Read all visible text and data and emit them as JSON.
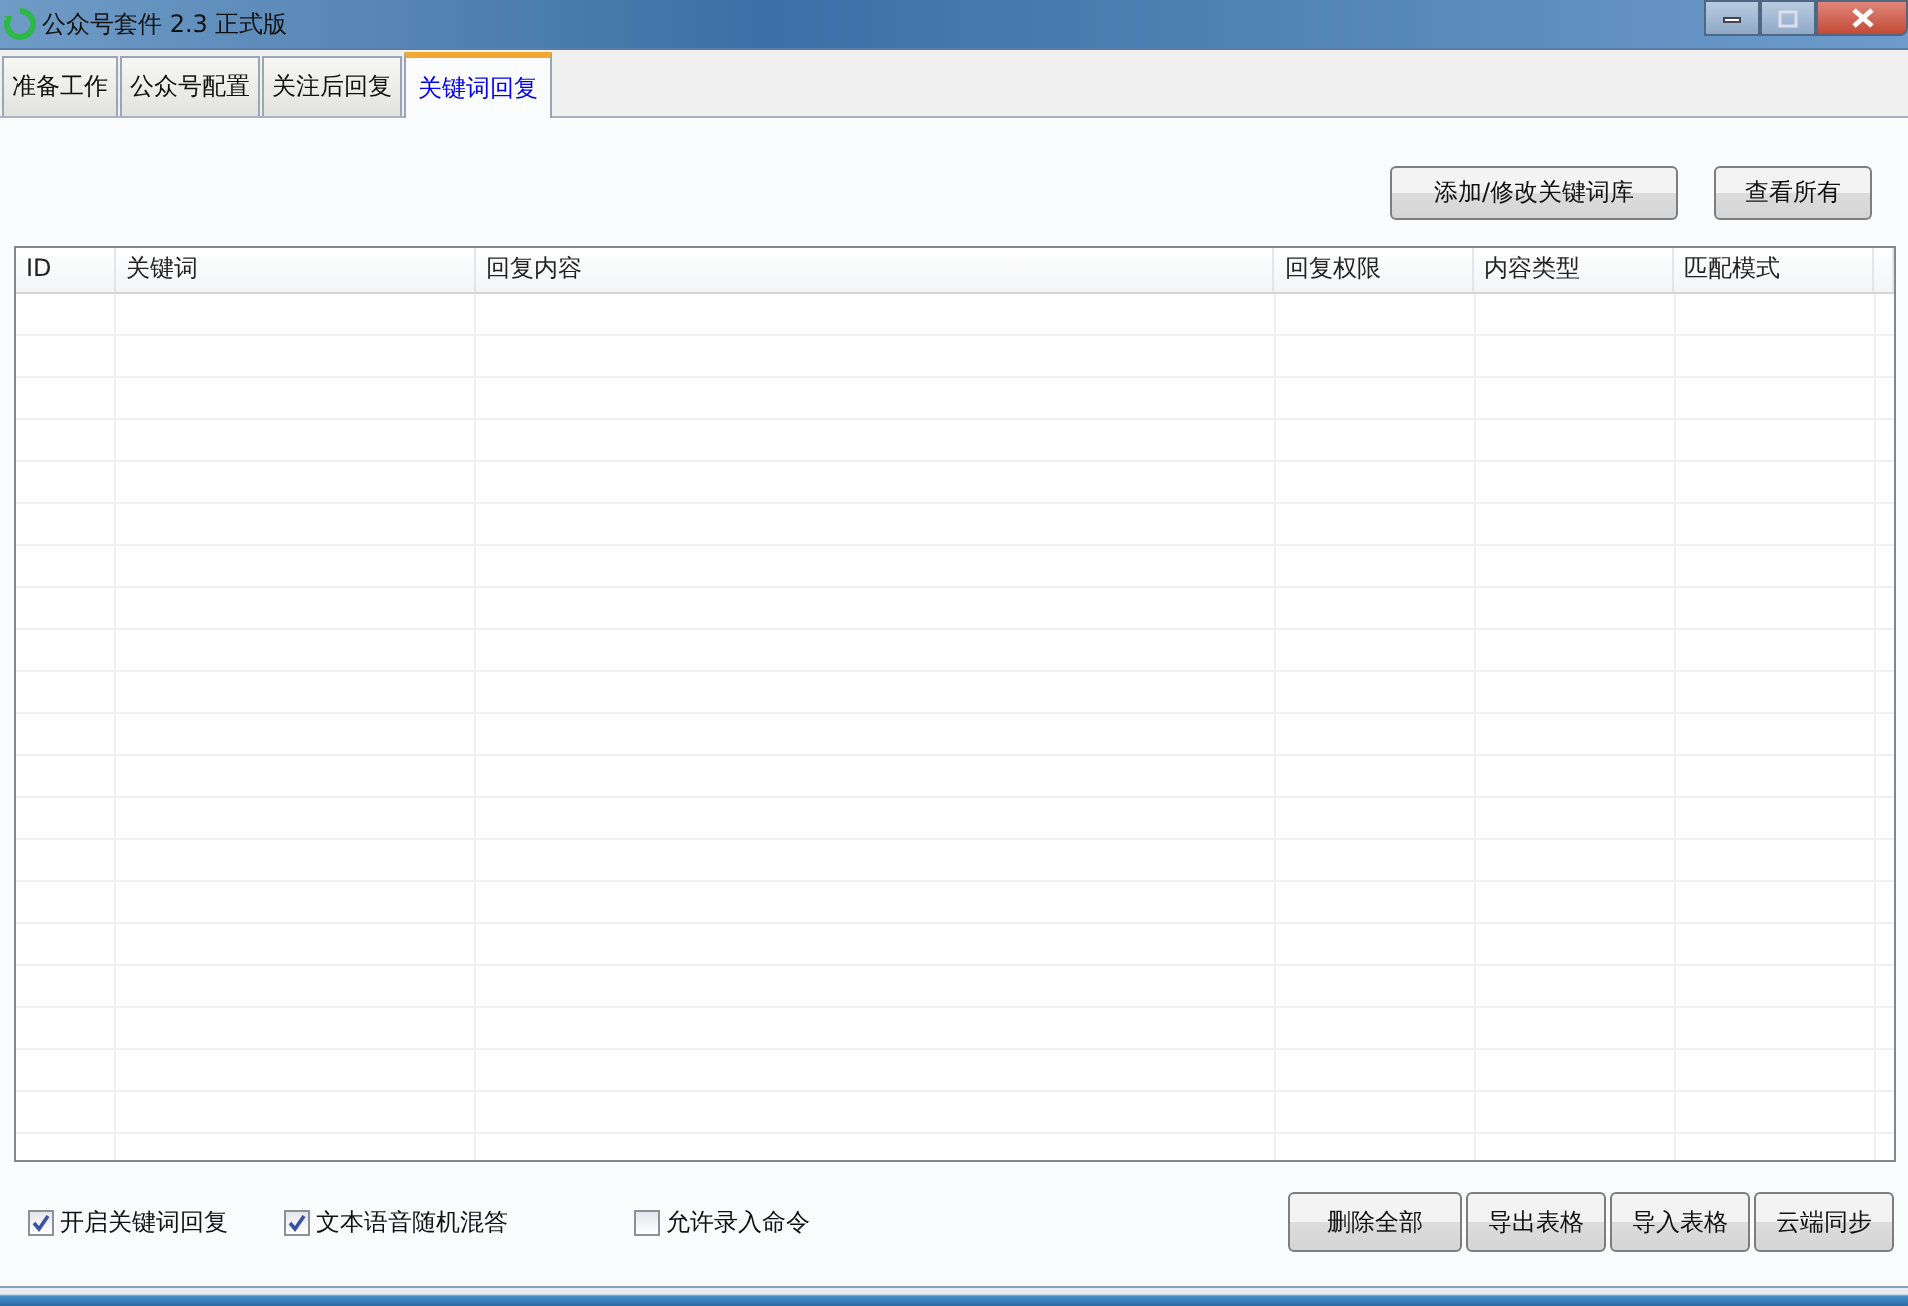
{
  "window": {
    "title": "公众号套件 2.3 正式版"
  },
  "tabs": [
    {
      "label": "准备工作",
      "selected": false
    },
    {
      "label": "公众号配置",
      "selected": false
    },
    {
      "label": "关注后回复",
      "selected": false
    },
    {
      "label": "关键词回复",
      "selected": true
    }
  ],
  "top_buttons": [
    "添加/修改关键词库",
    "查看所有"
  ],
  "table": {
    "columns": [
      "ID",
      "关键词",
      "回复内容",
      "回复权限",
      "内容类型",
      "匹配模式"
    ]
  },
  "options": [
    {
      "label": "开启关键词回复",
      "checked": true
    },
    {
      "label": "文本语音随机混答",
      "checked": true
    },
    {
      "label": "允许录入命令",
      "checked": false
    }
  ],
  "bottom_buttons": [
    "删除全部",
    "导出表格",
    "导入表格",
    "云端同步"
  ]
}
